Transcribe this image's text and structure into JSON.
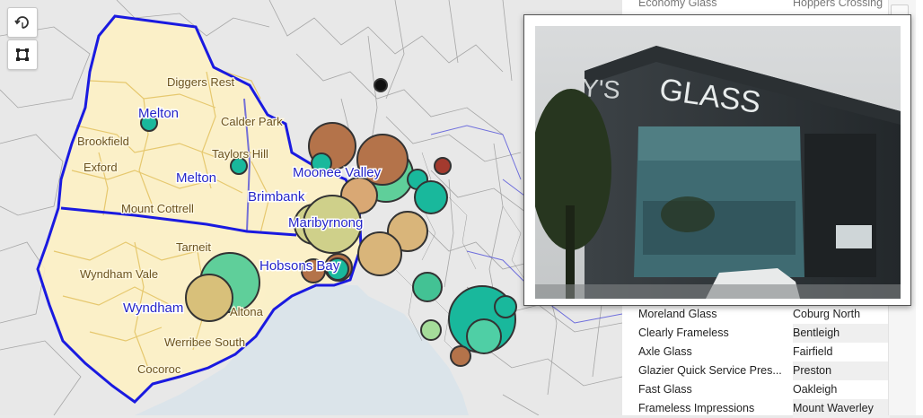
{
  "map": {
    "region_labels": [
      {
        "name": "Diggers Rest",
        "kind": "suburb"
      },
      {
        "name": "Melton",
        "kind": "lga"
      },
      {
        "name": "Calder Park",
        "kind": "suburb"
      },
      {
        "name": "Brookfield",
        "kind": "suburb"
      },
      {
        "name": "Taylors Hill",
        "kind": "suburb"
      },
      {
        "name": "Moonee Valley",
        "kind": "lga"
      },
      {
        "name": "Exford",
        "kind": "suburb"
      },
      {
        "name": "Melton",
        "kind": "lga"
      },
      {
        "name": "Brimbank",
        "kind": "lga"
      },
      {
        "name": "Mount Cottrell",
        "kind": "suburb"
      },
      {
        "name": "Maribyrnong",
        "kind": "lga"
      },
      {
        "name": "Tarneit",
        "kind": "suburb"
      },
      {
        "name": "Wyndham Vale",
        "kind": "suburb"
      },
      {
        "name": "Hobsons Bay",
        "kind": "lga"
      },
      {
        "name": "Wyndham",
        "kind": "lga"
      },
      {
        "name": "Altona",
        "kind": "suburb"
      },
      {
        "name": "Werribee South",
        "kind": "suburb"
      },
      {
        "name": "Cocoroc",
        "kind": "suburb"
      }
    ],
    "controls": {
      "reset_icon": "rotate-arrow-icon",
      "select_icon": "rectangle-select-icon"
    },
    "colors": {
      "highlight_fill": "#fdf1c4",
      "highlight_outline": "#1a1ae0",
      "water": "#d9e3ea",
      "bubble_teal": "#19b89c",
      "bubble_green": "#5fcf9a",
      "bubble_tan": "#d9b57a",
      "bubble_brown": "#b4734a",
      "bubble_olive": "#cfd08a",
      "bubble_red": "#a33a2e"
    }
  },
  "popup": {
    "photo_sign": "GLASS",
    "photo_sign_partial": "Y'S"
  },
  "table": {
    "hidden_row": {
      "business": "Economy Glass",
      "suburb": "Hoppers Crossing"
    },
    "rows": [
      {
        "business": "Moreland Glass",
        "suburb": "Coburg North"
      },
      {
        "business": "Clearly Frameless",
        "suburb": "Bentleigh"
      },
      {
        "business": "Axle Glass",
        "suburb": "Fairfield"
      },
      {
        "business": "Glazier Quick Service Pres...",
        "suburb": "Preston"
      },
      {
        "business": "Fast Glass",
        "suburb": "Oakleigh"
      },
      {
        "business": "Frameless Impressions",
        "suburb": "Mount Waverley"
      }
    ]
  }
}
